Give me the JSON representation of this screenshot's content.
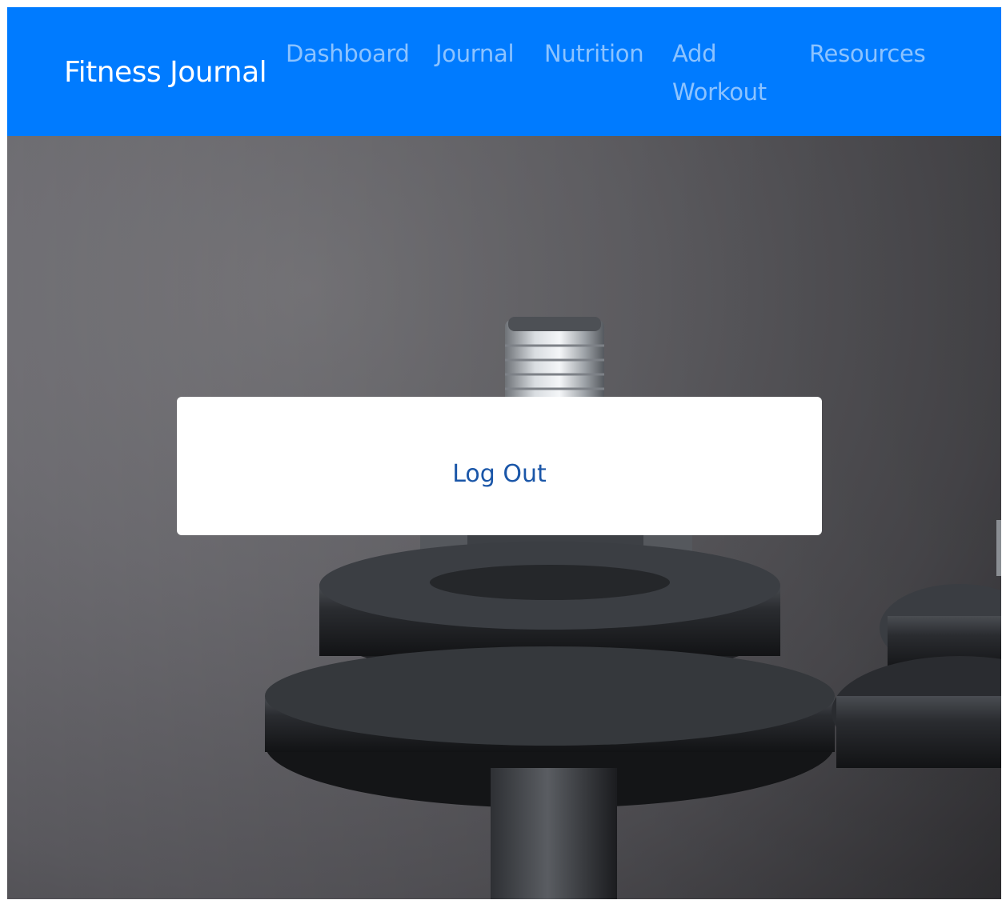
{
  "navbar": {
    "brand": "Fitness Journal",
    "links": [
      "Dashboard",
      "Journal",
      "Nutrition",
      "Add Workout",
      "Resources"
    ],
    "background": "#007bff"
  },
  "hero": {
    "image": "dumbbell-photo"
  },
  "card": {
    "action_label": "Log Out",
    "link_color": "#1a56a8"
  }
}
